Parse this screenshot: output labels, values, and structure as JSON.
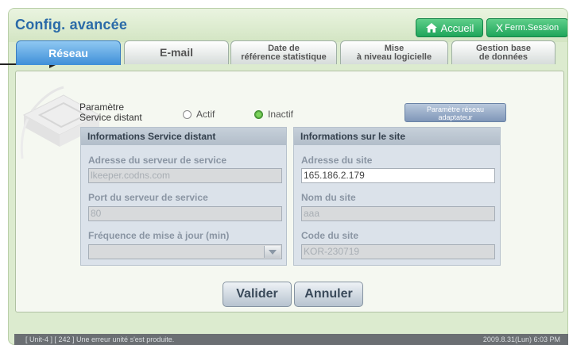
{
  "window": {
    "title": "Config. avancée"
  },
  "header": {
    "home_label": "Accueil",
    "logout_label": "Ferm.Session"
  },
  "tabs": [
    {
      "label": "Réseau",
      "active": true
    },
    {
      "label": "E-mail",
      "active": false
    },
    {
      "label_line1": "Date de",
      "label_line2": "référence statistique",
      "active": false
    },
    {
      "label_line1": "Mise",
      "label_line2": "à niveau logicielle",
      "active": false
    },
    {
      "label_line1": "Gestion base",
      "label_line2": "de données",
      "active": false
    }
  ],
  "remote_service": {
    "label_line1": "Paramètre",
    "label_line2": "Service distant",
    "option_actif": "Actif",
    "option_inactif": "Inactif",
    "selected": "Inactif"
  },
  "adapter_button": {
    "line1": "Paramètre réseau",
    "line2": "adaptateur"
  },
  "remote_info": {
    "header": "Informations Service distant",
    "server_address_label": "Adresse du serveur de service",
    "server_address_value": "lkeeper.codns.com",
    "server_port_label": "Port du serveur de service",
    "server_port_value": "80",
    "update_freq_label": "Fréquence de mise à jour (min)",
    "update_freq_value": ""
  },
  "site_info": {
    "header": "Informations sur le site",
    "site_address_label": "Adresse du site",
    "site_address_value": "165.186.2.179",
    "site_name_label": "Nom du site",
    "site_name_value": "aaa",
    "site_code_label": "Code du site",
    "site_code_value": "KOR-230719"
  },
  "actions": {
    "validate_label": "Valider",
    "cancel_label": "Annuler"
  },
  "status": {
    "message": "[ Unit-4 ] [ 242 ] Une erreur unité s'est produite.",
    "datetime": "2009.8.31(Lun)  6:03 PM"
  },
  "colors": {
    "accent_blue": "#3f8fd8",
    "header_green": "#1fa55a",
    "title_blue": "#2a6aa8"
  }
}
